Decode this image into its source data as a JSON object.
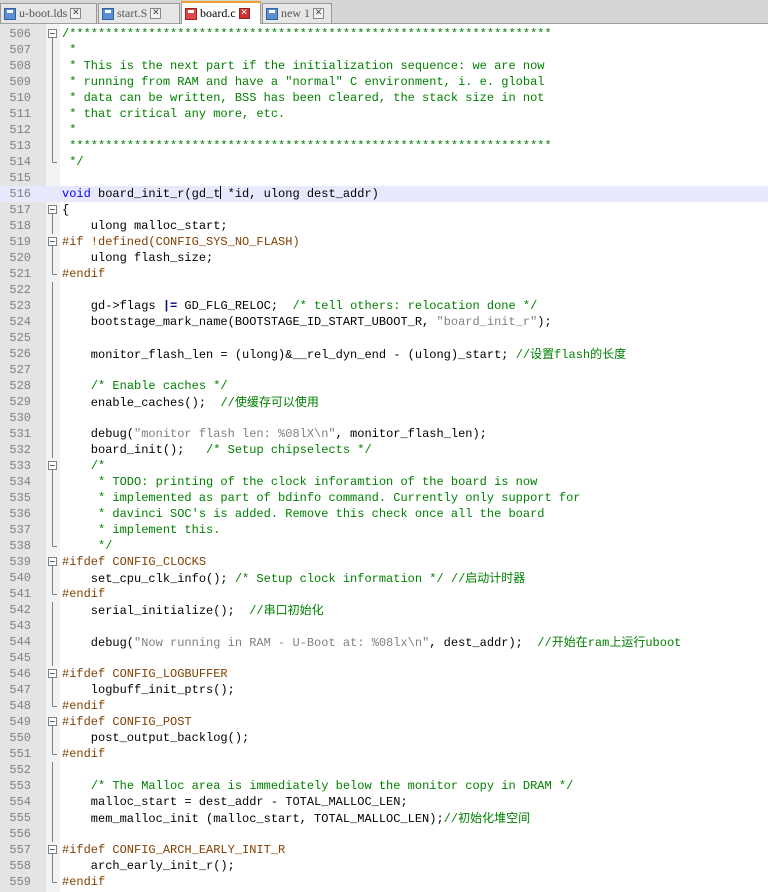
{
  "tabs": [
    {
      "label": "u-boot.lds",
      "active": false,
      "icon": "file-icon"
    },
    {
      "label": "start.S",
      "active": false,
      "icon": "file-icon"
    },
    {
      "label": "board.c",
      "active": true,
      "icon": "modified-file-icon"
    },
    {
      "label": "new 1",
      "active": false,
      "icon": "file-icon"
    }
  ],
  "colors": {
    "comment": "#008000",
    "keyword": "#0000ff",
    "preprocessor": "#804000",
    "string": "#808080",
    "line_number": "#808080",
    "current_line": "#e8e8ff"
  },
  "lines": [
    {
      "n": "506",
      "fold": "start",
      "tokens": [
        [
          "cm",
          "/*******************************************************************"
        ]
      ]
    },
    {
      "n": "507",
      "fold": "bar",
      "tokens": [
        [
          "cm",
          " *"
        ]
      ]
    },
    {
      "n": "508",
      "fold": "bar",
      "tokens": [
        [
          "cm",
          " * This is the next part if the initialization sequence: we are now"
        ]
      ]
    },
    {
      "n": "509",
      "fold": "bar",
      "tokens": [
        [
          "cm",
          " * running from RAM and have a \"normal\" C environment, i. e. global"
        ]
      ]
    },
    {
      "n": "510",
      "fold": "bar",
      "tokens": [
        [
          "cm",
          " * data can be written, BSS has been cleared, the stack size in not"
        ]
      ]
    },
    {
      "n": "511",
      "fold": "bar",
      "tokens": [
        [
          "cm",
          " * that critical any more, etc."
        ]
      ]
    },
    {
      "n": "512",
      "fold": "bar",
      "tokens": [
        [
          "cm",
          " *"
        ]
      ]
    },
    {
      "n": "513",
      "fold": "bar",
      "tokens": [
        [
          "cm",
          " *******************************************************************"
        ]
      ]
    },
    {
      "n": "514",
      "fold": "end",
      "tokens": [
        [
          "cm",
          " */"
        ]
      ]
    },
    {
      "n": "515",
      "fold": "",
      "tokens": []
    },
    {
      "n": "516",
      "fold": "",
      "current": true,
      "tokens": [
        [
          "kw",
          "void"
        ],
        [
          "",
          " board_init_r(gd_t"
        ],
        [
          "caret",
          ""
        ],
        [
          "",
          " *id, ulong dest_addr)"
        ]
      ]
    },
    {
      "n": "517",
      "fold": "start",
      "tokens": [
        [
          "",
          "{"
        ]
      ]
    },
    {
      "n": "518",
      "fold": "bar",
      "tokens": [
        [
          "",
          "    ulong malloc_start;"
        ]
      ]
    },
    {
      "n": "519",
      "fold": "start",
      "tokens": [
        [
          "pp",
          "#if !defined(CONFIG_SYS_NO_FLASH)"
        ]
      ]
    },
    {
      "n": "520",
      "fold": "bar",
      "tokens": [
        [
          "",
          "    ulong flash_size;"
        ]
      ]
    },
    {
      "n": "521",
      "fold": "end",
      "tokens": [
        [
          "pp",
          "#endif"
        ]
      ]
    },
    {
      "n": "522",
      "fold": "bar",
      "tokens": []
    },
    {
      "n": "523",
      "fold": "bar",
      "tokens": [
        [
          "",
          "    gd->flags "
        ],
        [
          "op",
          "|="
        ],
        [
          "",
          " GD_FLG_RELOC;  "
        ],
        [
          "cm",
          "/* tell others: relocation done */"
        ]
      ]
    },
    {
      "n": "524",
      "fold": "bar",
      "tokens": [
        [
          "",
          "    bootstage_mark_name(BOOTSTAGE_ID_START_UBOOT_R, "
        ],
        [
          "st",
          "\"board_init_r\""
        ],
        [
          "",
          ");"
        ]
      ]
    },
    {
      "n": "525",
      "fold": "bar",
      "tokens": []
    },
    {
      "n": "526",
      "fold": "bar",
      "tokens": [
        [
          "",
          "    monitor_flash_len = (ulong)&__rel_dyn_end - (ulong)_start; "
        ],
        [
          "cm",
          "//设置flash的长度"
        ]
      ]
    },
    {
      "n": "527",
      "fold": "bar",
      "tokens": []
    },
    {
      "n": "528",
      "fold": "bar",
      "tokens": [
        [
          "",
          "    "
        ],
        [
          "cm",
          "/* Enable caches */"
        ]
      ]
    },
    {
      "n": "529",
      "fold": "bar",
      "tokens": [
        [
          "",
          "    enable_caches();  "
        ],
        [
          "cm",
          "//使缓存可以使用"
        ]
      ]
    },
    {
      "n": "530",
      "fold": "bar",
      "tokens": []
    },
    {
      "n": "531",
      "fold": "bar",
      "tokens": [
        [
          "",
          "    debug("
        ],
        [
          "st",
          "\"monitor flash len: %08lX\\n\""
        ],
        [
          "",
          ", monitor_flash_len);"
        ]
      ]
    },
    {
      "n": "532",
      "fold": "bar",
      "tokens": [
        [
          "",
          "    board_init();   "
        ],
        [
          "cm",
          "/* Setup chipselects */"
        ]
      ]
    },
    {
      "n": "533",
      "fold": "start",
      "tokens": [
        [
          "",
          "    "
        ],
        [
          "cm",
          "/*"
        ]
      ]
    },
    {
      "n": "534",
      "fold": "bar",
      "tokens": [
        [
          "cm",
          "     * TODO: printing of the clock inforamtion of the board is now"
        ]
      ]
    },
    {
      "n": "535",
      "fold": "bar",
      "tokens": [
        [
          "cm",
          "     * implemented as part of bdinfo command. Currently only support for"
        ]
      ]
    },
    {
      "n": "536",
      "fold": "bar",
      "tokens": [
        [
          "cm",
          "     * davinci SOC's is added. Remove this check once all the board"
        ]
      ]
    },
    {
      "n": "537",
      "fold": "bar",
      "tokens": [
        [
          "cm",
          "     * implement this."
        ]
      ]
    },
    {
      "n": "538",
      "fold": "end",
      "tokens": [
        [
          "cm",
          "     */"
        ]
      ]
    },
    {
      "n": "539",
      "fold": "start",
      "tokens": [
        [
          "pp",
          "#ifdef CONFIG_CLOCKS"
        ]
      ]
    },
    {
      "n": "540",
      "fold": "bar",
      "tokens": [
        [
          "",
          "    set_cpu_clk_info(); "
        ],
        [
          "cm",
          "/* Setup clock information */ //启动计时器"
        ]
      ]
    },
    {
      "n": "541",
      "fold": "end",
      "tokens": [
        [
          "pp",
          "#endif"
        ]
      ]
    },
    {
      "n": "542",
      "fold": "bar",
      "tokens": [
        [
          "",
          "    serial_initialize();  "
        ],
        [
          "cm",
          "//串口初始化"
        ]
      ]
    },
    {
      "n": "543",
      "fold": "bar",
      "tokens": []
    },
    {
      "n": "544",
      "fold": "bar",
      "tokens": [
        [
          "",
          "    debug("
        ],
        [
          "st",
          "\"Now running in RAM - U-Boot at: %08lx\\n\""
        ],
        [
          "",
          ", dest_addr);  "
        ],
        [
          "cm",
          "//开始在ram上运行uboot"
        ]
      ]
    },
    {
      "n": "545",
      "fold": "bar",
      "tokens": []
    },
    {
      "n": "546",
      "fold": "start",
      "tokens": [
        [
          "pp",
          "#ifdef CONFIG_LOGBUFFER"
        ]
      ]
    },
    {
      "n": "547",
      "fold": "bar",
      "tokens": [
        [
          "",
          "    logbuff_init_ptrs();"
        ]
      ]
    },
    {
      "n": "548",
      "fold": "end",
      "tokens": [
        [
          "pp",
          "#endif"
        ]
      ]
    },
    {
      "n": "549",
      "fold": "start",
      "tokens": [
        [
          "pp",
          "#ifdef CONFIG_POST"
        ]
      ]
    },
    {
      "n": "550",
      "fold": "bar",
      "tokens": [
        [
          "",
          "    post_output_backlog();"
        ]
      ]
    },
    {
      "n": "551",
      "fold": "end",
      "tokens": [
        [
          "pp",
          "#endif"
        ]
      ]
    },
    {
      "n": "552",
      "fold": "bar",
      "tokens": []
    },
    {
      "n": "553",
      "fold": "bar",
      "tokens": [
        [
          "",
          "    "
        ],
        [
          "cm",
          "/* The Malloc area is immediately below the monitor copy in DRAM */"
        ]
      ]
    },
    {
      "n": "554",
      "fold": "bar",
      "tokens": [
        [
          "",
          "    malloc_start = dest_addr - TOTAL_MALLOC_LEN;"
        ]
      ]
    },
    {
      "n": "555",
      "fold": "bar",
      "tokens": [
        [
          "",
          "    mem_malloc_init (malloc_start, TOTAL_MALLOC_LEN);"
        ],
        [
          "cm",
          "//初始化堆空间"
        ]
      ]
    },
    {
      "n": "556",
      "fold": "bar",
      "tokens": []
    },
    {
      "n": "557",
      "fold": "start",
      "tokens": [
        [
          "pp",
          "#ifdef CONFIG_ARCH_EARLY_INIT_R"
        ]
      ]
    },
    {
      "n": "558",
      "fold": "bar",
      "tokens": [
        [
          "",
          "    arch_early_init_r();"
        ]
      ]
    },
    {
      "n": "559",
      "fold": "end",
      "tokens": [
        [
          "pp",
          "#endif"
        ]
      ]
    }
  ]
}
